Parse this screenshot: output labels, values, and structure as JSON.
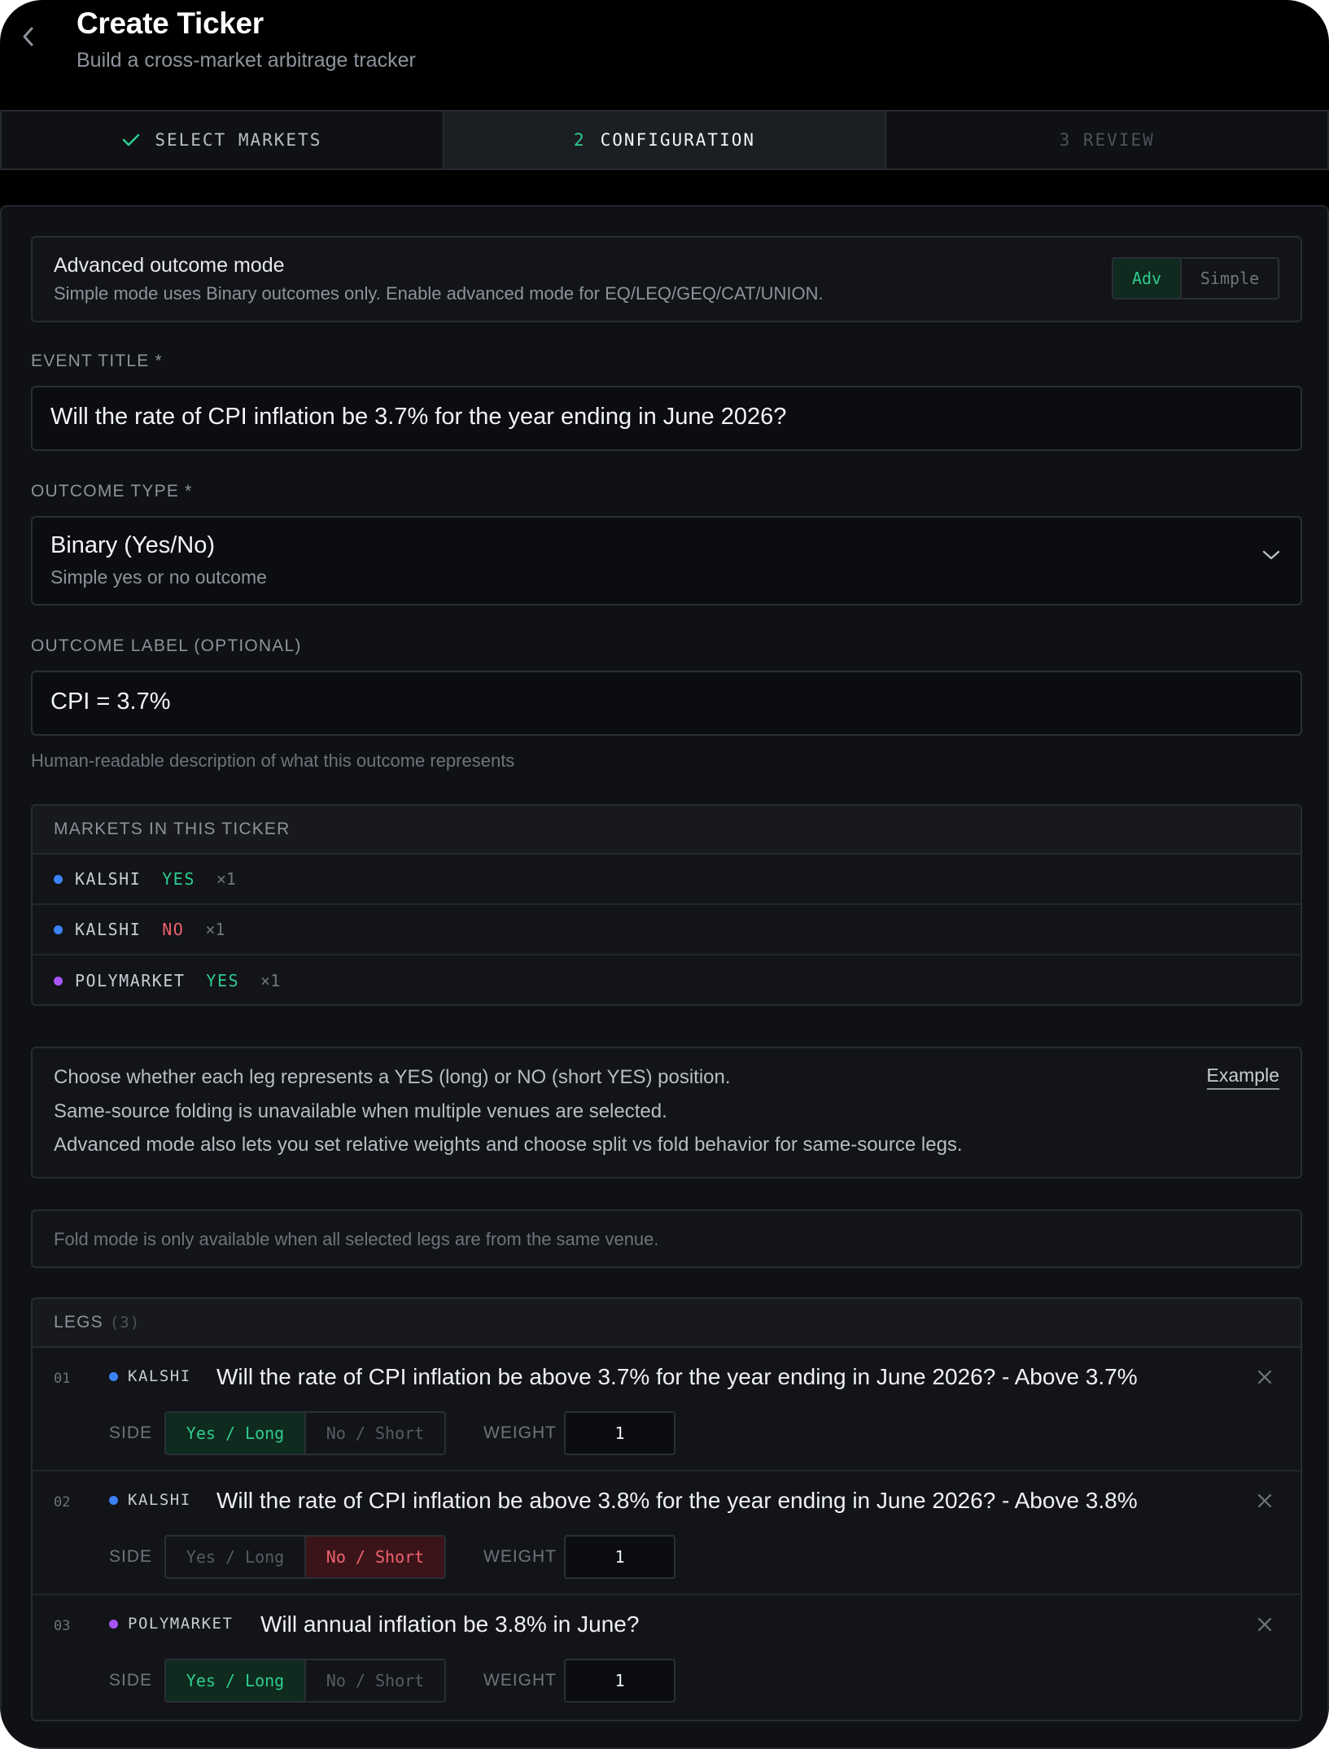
{
  "header": {
    "title": "Create Ticker",
    "subtitle": "Build a cross-market arbitrage tracker"
  },
  "stepper": {
    "steps": [
      {
        "label": "SELECT MARKETS",
        "state": "done"
      },
      {
        "number": "2",
        "label": "CONFIGURATION",
        "state": "active"
      },
      {
        "label": "3 REVIEW",
        "state": "pending"
      }
    ]
  },
  "advanced_mode": {
    "title": "Advanced outcome mode",
    "description": "Simple mode uses Binary outcomes only. Enable advanced mode for EQ/LEQ/GEQ/CAT/UNION.",
    "toggle_on": "Adv",
    "toggle_off": "Simple",
    "selected": "Adv"
  },
  "event_title": {
    "label": "EVENT TITLE *",
    "value": "Will the rate of CPI inflation be 3.7% for the year ending in June 2026?"
  },
  "outcome_type": {
    "label": "OUTCOME TYPE *",
    "value": "Binary (Yes/No)",
    "description": "Simple yes or no outcome"
  },
  "outcome_label": {
    "label": "OUTCOME LABEL (OPTIONAL)",
    "value": "CPI = 3.7%",
    "helper": "Human-readable description of what this outcome represents"
  },
  "markets": {
    "header": "MARKETS IN THIS TICKER",
    "rows": [
      {
        "venue": "KALSHI",
        "side": "YES",
        "multiplier": "×1",
        "venue_color": "#3b82f6"
      },
      {
        "venue": "KALSHI",
        "side": "NO",
        "multiplier": "×1",
        "venue_color": "#3b82f6"
      },
      {
        "venue": "POLYMARKET",
        "side": "YES",
        "multiplier": "×1",
        "venue_color": "#a855f7"
      }
    ]
  },
  "info": {
    "lines": [
      "Choose whether each leg represents a YES (long) or NO (short YES) position.",
      "Same-source folding is unavailable when multiple venues are selected.",
      "Advanced mode also lets you set relative weights and choose split vs fold behavior for same-source legs."
    ],
    "example_link": "Example"
  },
  "fold_notice": "Fold mode is only available when all selected legs are from the same venue.",
  "legs": {
    "header": "LEGS",
    "count": "(3)",
    "side_label": "SIDE",
    "weight_label": "WEIGHT",
    "yes_label": "Yes / Long",
    "no_label": "No / Short",
    "items": [
      {
        "index": "01",
        "venue": "KALSHI",
        "venue_color": "#3b82f6",
        "question": "Will the rate of CPI inflation be above 3.7% for the year ending in June 2026? - Above 3.7%",
        "side": "yes",
        "weight": "1"
      },
      {
        "index": "02",
        "venue": "KALSHI",
        "venue_color": "#3b82f6",
        "question": "Will the rate of CPI inflation be above 3.8% for the year ending in June 2026? - Above 3.8%",
        "side": "no",
        "weight": "1"
      },
      {
        "index": "03",
        "venue": "POLYMARKET",
        "venue_color": "#a855f7",
        "question": "Will annual inflation be 3.8% in June?",
        "side": "yes",
        "weight": "1"
      }
    ]
  },
  "colors": {
    "accent_green": "#2ecc8f",
    "accent_red": "#f0616d",
    "kalshi": "#3b82f6",
    "polymarket": "#a855f7"
  }
}
